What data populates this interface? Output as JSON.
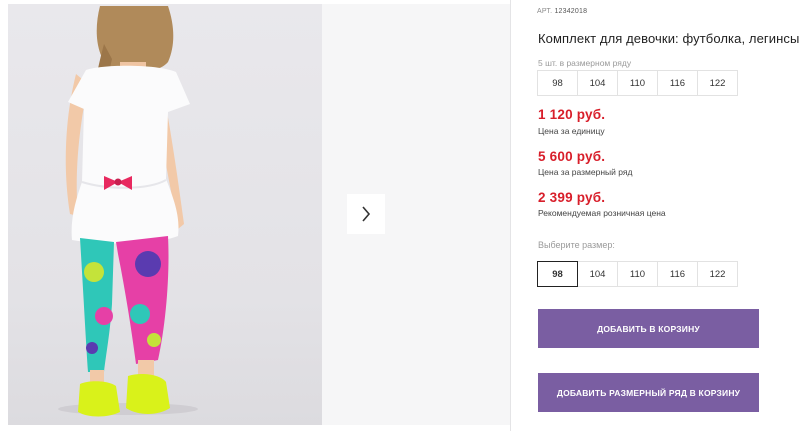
{
  "product": {
    "sku_label": "АРТ.",
    "sku_value": "12342018",
    "title": "Комплект для девочки: футболка, легинсы"
  },
  "size_run": {
    "label": "5 шт. в размерном ряду",
    "sizes": [
      "98",
      "104",
      "110",
      "116",
      "122"
    ]
  },
  "prices": {
    "unit_price": "1 120 руб.",
    "unit_price_label": "Цена за единицу",
    "run_price": "5 600 руб.",
    "run_price_label": "Цена за размерный ряд",
    "retail_price": "2 399 руб.",
    "retail_price_label": "Рекомендуемая розничная цена",
    "color": "#d81e2a"
  },
  "size_select": {
    "label": "Выберите размер:",
    "sizes": [
      "98",
      "104",
      "110",
      "116",
      "122"
    ],
    "selected": "98"
  },
  "actions": {
    "add_to_cart": "ДОБАВИТЬ В КОРЗИНУ",
    "add_run_to_cart": "ДОБАВИТЬ РАЗМЕРНЫЙ РЯД В КОРЗИНУ",
    "button_color": "#7a5ea2"
  },
  "gallery": {
    "next_icon": "chevron-right-icon"
  }
}
